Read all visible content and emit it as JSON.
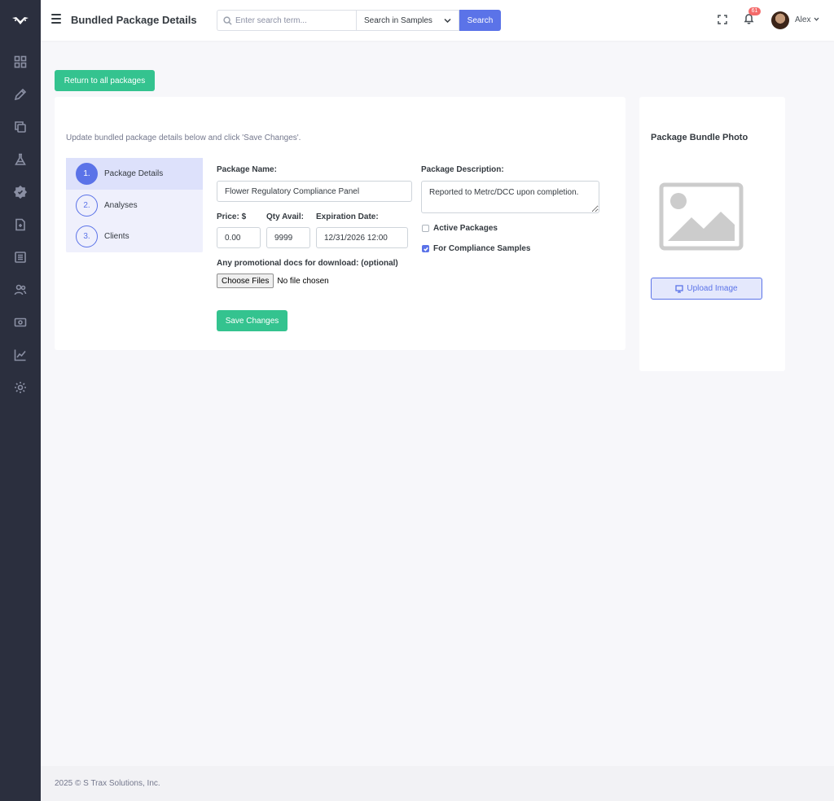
{
  "header": {
    "title": "Bundled Package Details",
    "search_placeholder": "Enter search term...",
    "search_scope": "Search in Samples",
    "search_button": "Search",
    "notification_count": "61",
    "user_name": "Alex"
  },
  "sidebar": {
    "items": [
      {
        "icon": "dashboard-icon"
      },
      {
        "icon": "pencil-icon"
      },
      {
        "icon": "copy-icon"
      },
      {
        "icon": "flask-icon"
      },
      {
        "icon": "verified-badge-icon"
      },
      {
        "icon": "document-icon"
      },
      {
        "icon": "list-icon"
      },
      {
        "icon": "users-icon"
      },
      {
        "icon": "money-icon"
      },
      {
        "icon": "chart-icon"
      },
      {
        "icon": "gear-icon"
      }
    ]
  },
  "main": {
    "return_button": "Return to all packages",
    "intro": "Update bundled package details below and click 'Save Changes'.",
    "steps": [
      {
        "number": "1.",
        "label": "Package Details",
        "active": true
      },
      {
        "number": "2.",
        "label": "Analyses",
        "active": false
      },
      {
        "number": "3.",
        "label": "Clients",
        "active": false
      }
    ],
    "form": {
      "package_name_label": "Package Name:",
      "package_name_value": "Flower Regulatory Compliance Panel",
      "price_label": "Price: $",
      "price_value": "0.00",
      "qty_label": "Qty Avail:",
      "qty_value": "9999",
      "expiration_label": "Expiration Date:",
      "expiration_value": "12/31/2026 12:00",
      "promo_label": "Any promotional docs for download: (optional)",
      "file_button": "Choose Files",
      "file_status": "No file chosen",
      "description_label": "Package Description:",
      "description_value": "Reported to Metrc/DCC upon completion.",
      "active_packages_label": "Active Packages",
      "active_packages_checked": false,
      "compliance_label": "For Compliance Samples",
      "compliance_checked": true,
      "save_button": "Save Changes"
    }
  },
  "photo": {
    "title": "Package Bundle Photo",
    "upload_button": "Upload Image"
  },
  "footer": {
    "text": "2025 © S Trax Solutions, Inc."
  },
  "colors": {
    "primary": "#5b73e8",
    "success": "#34c38f",
    "sidebar": "#2b2f3e",
    "badge": "#f46a6a"
  }
}
